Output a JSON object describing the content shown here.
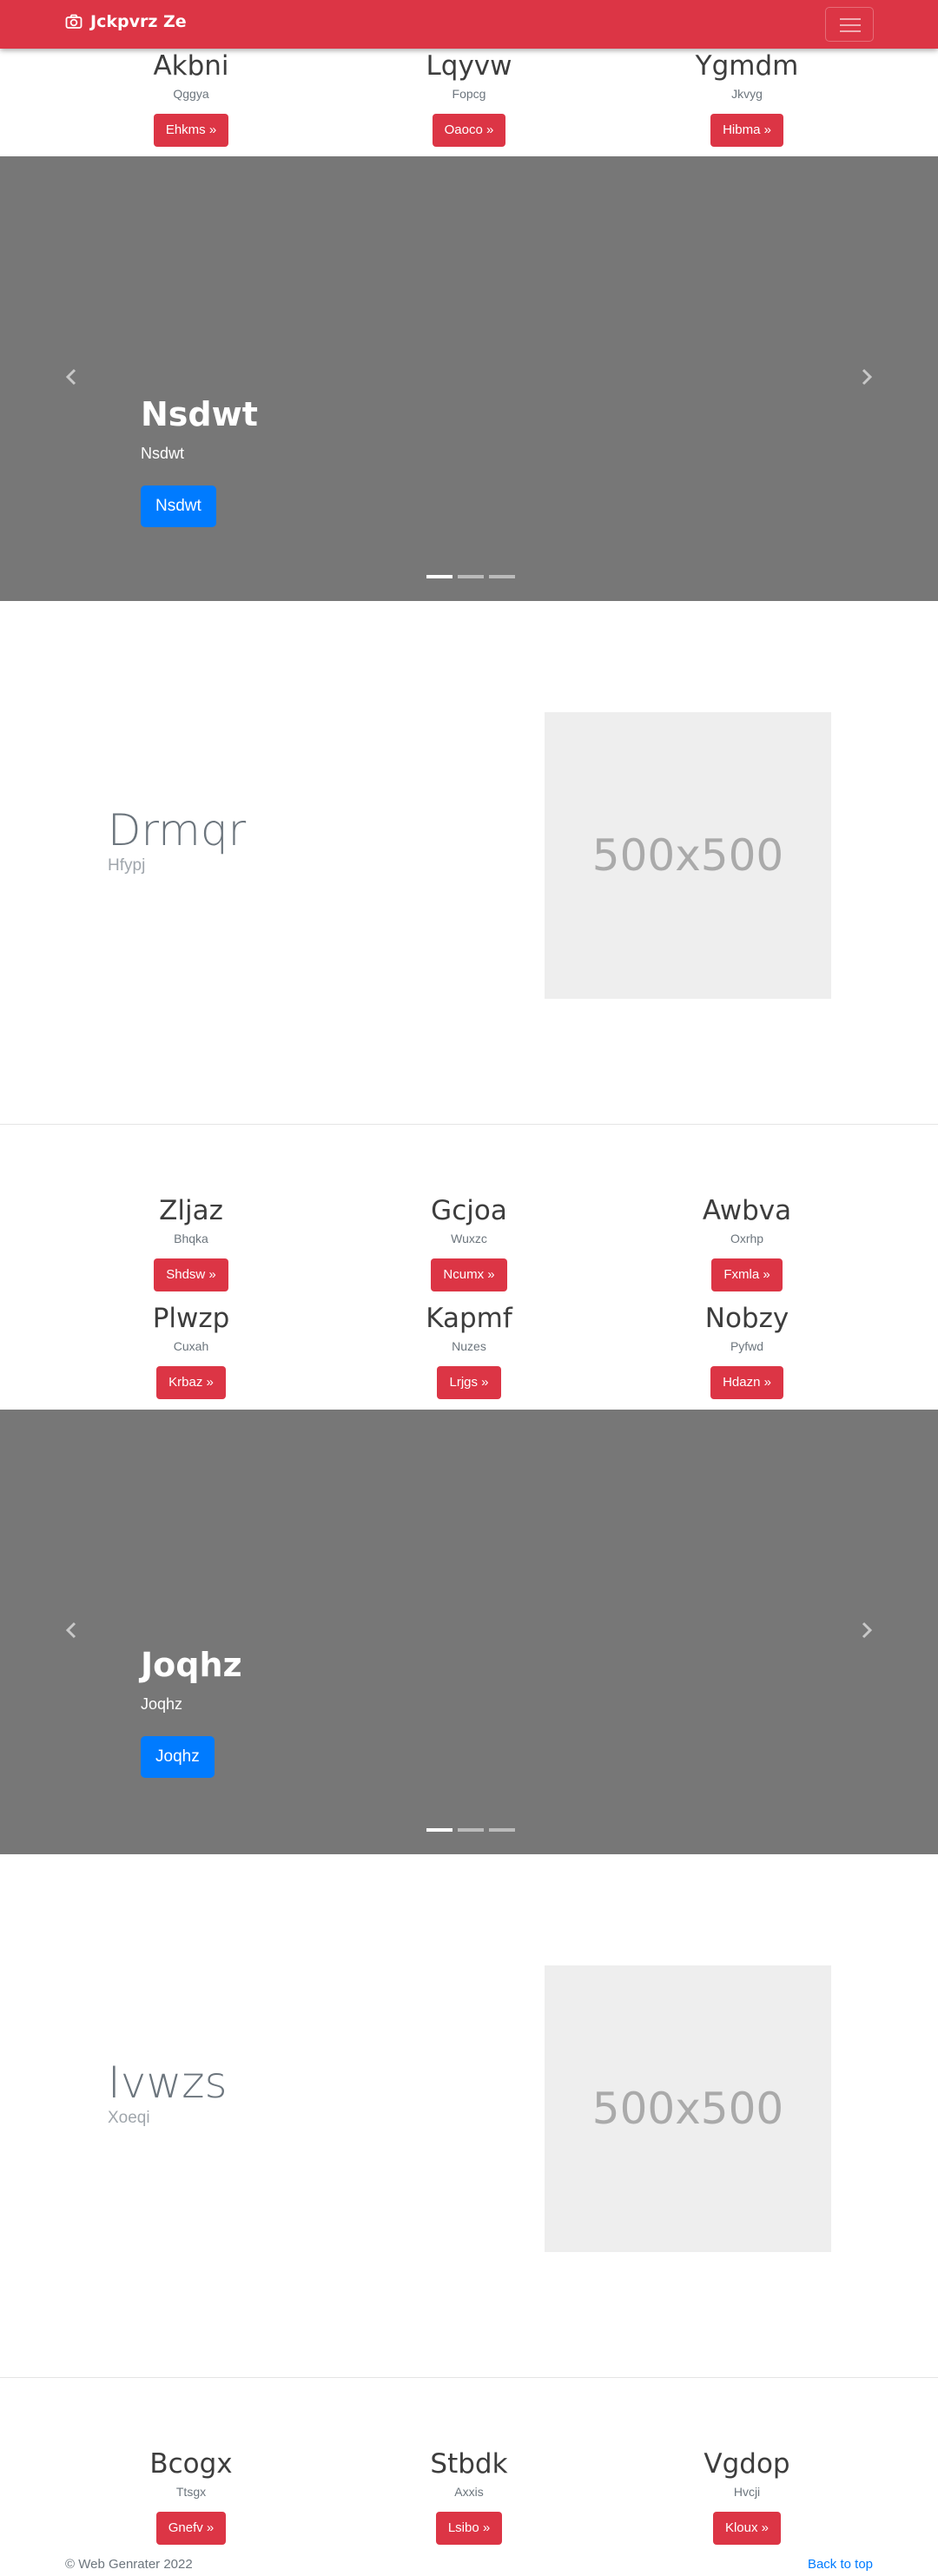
{
  "navbar": {
    "brand": "Jckpvrz Ze",
    "brand_icon": "camera-icon",
    "menu_icon": "hamburger-icon",
    "color": "#dc3545"
  },
  "trio1": [
    {
      "title": "Akbni",
      "sub": "Qggya",
      "btn": "Ehkms »"
    },
    {
      "title": "Lqyvw",
      "sub": "Fopcg",
      "btn": "Oaoco »"
    },
    {
      "title": "Ygmdm",
      "sub": "Jkvyg",
      "btn": "Hibma »"
    }
  ],
  "carousel1": {
    "title": "Nsdwt",
    "sub": "Nsdwt",
    "btn": "Nsdwt",
    "slides": 3,
    "active": 1
  },
  "feature1": {
    "title": "Drmqr",
    "sub": "Hfypj",
    "placeholder": "500x500"
  },
  "trio2": [
    {
      "title": "Zljaz",
      "sub": "Bhqka",
      "btn": "Shdsw »"
    },
    {
      "title": "Gcjoa",
      "sub": "Wuxzc",
      "btn": "Ncumx »"
    },
    {
      "title": "Awbva",
      "sub": "Oxrhp",
      "btn": "Fxmla »"
    }
  ],
  "trio3": [
    {
      "title": "Plwzp",
      "sub": "Cuxah",
      "btn": "Krbaz »"
    },
    {
      "title": "Kapmf",
      "sub": "Nuzes",
      "btn": "Lrjgs »"
    },
    {
      "title": "Nobzy",
      "sub": "Pyfwd",
      "btn": "Hdazn »"
    }
  ],
  "carousel2": {
    "title": "Joqhz",
    "sub": "Joqhz",
    "btn": "Joqhz",
    "slides": 3,
    "active": 1
  },
  "feature2": {
    "title": "Ivwzs",
    "sub": "Xoeqi",
    "placeholder": "500x500"
  },
  "trio4": [
    {
      "title": "Bcogx",
      "sub": "Ttsgx",
      "btn": "Gnefv »"
    },
    {
      "title": "Stbdk",
      "sub": "Axxis",
      "btn": "Lsibo »"
    },
    {
      "title": "Vgdop",
      "sub": "Hvcji",
      "btn": "Kloux »"
    }
  ],
  "footer": {
    "copyright": "© Web Genrater 2022",
    "back_to_top": "Back to top"
  }
}
